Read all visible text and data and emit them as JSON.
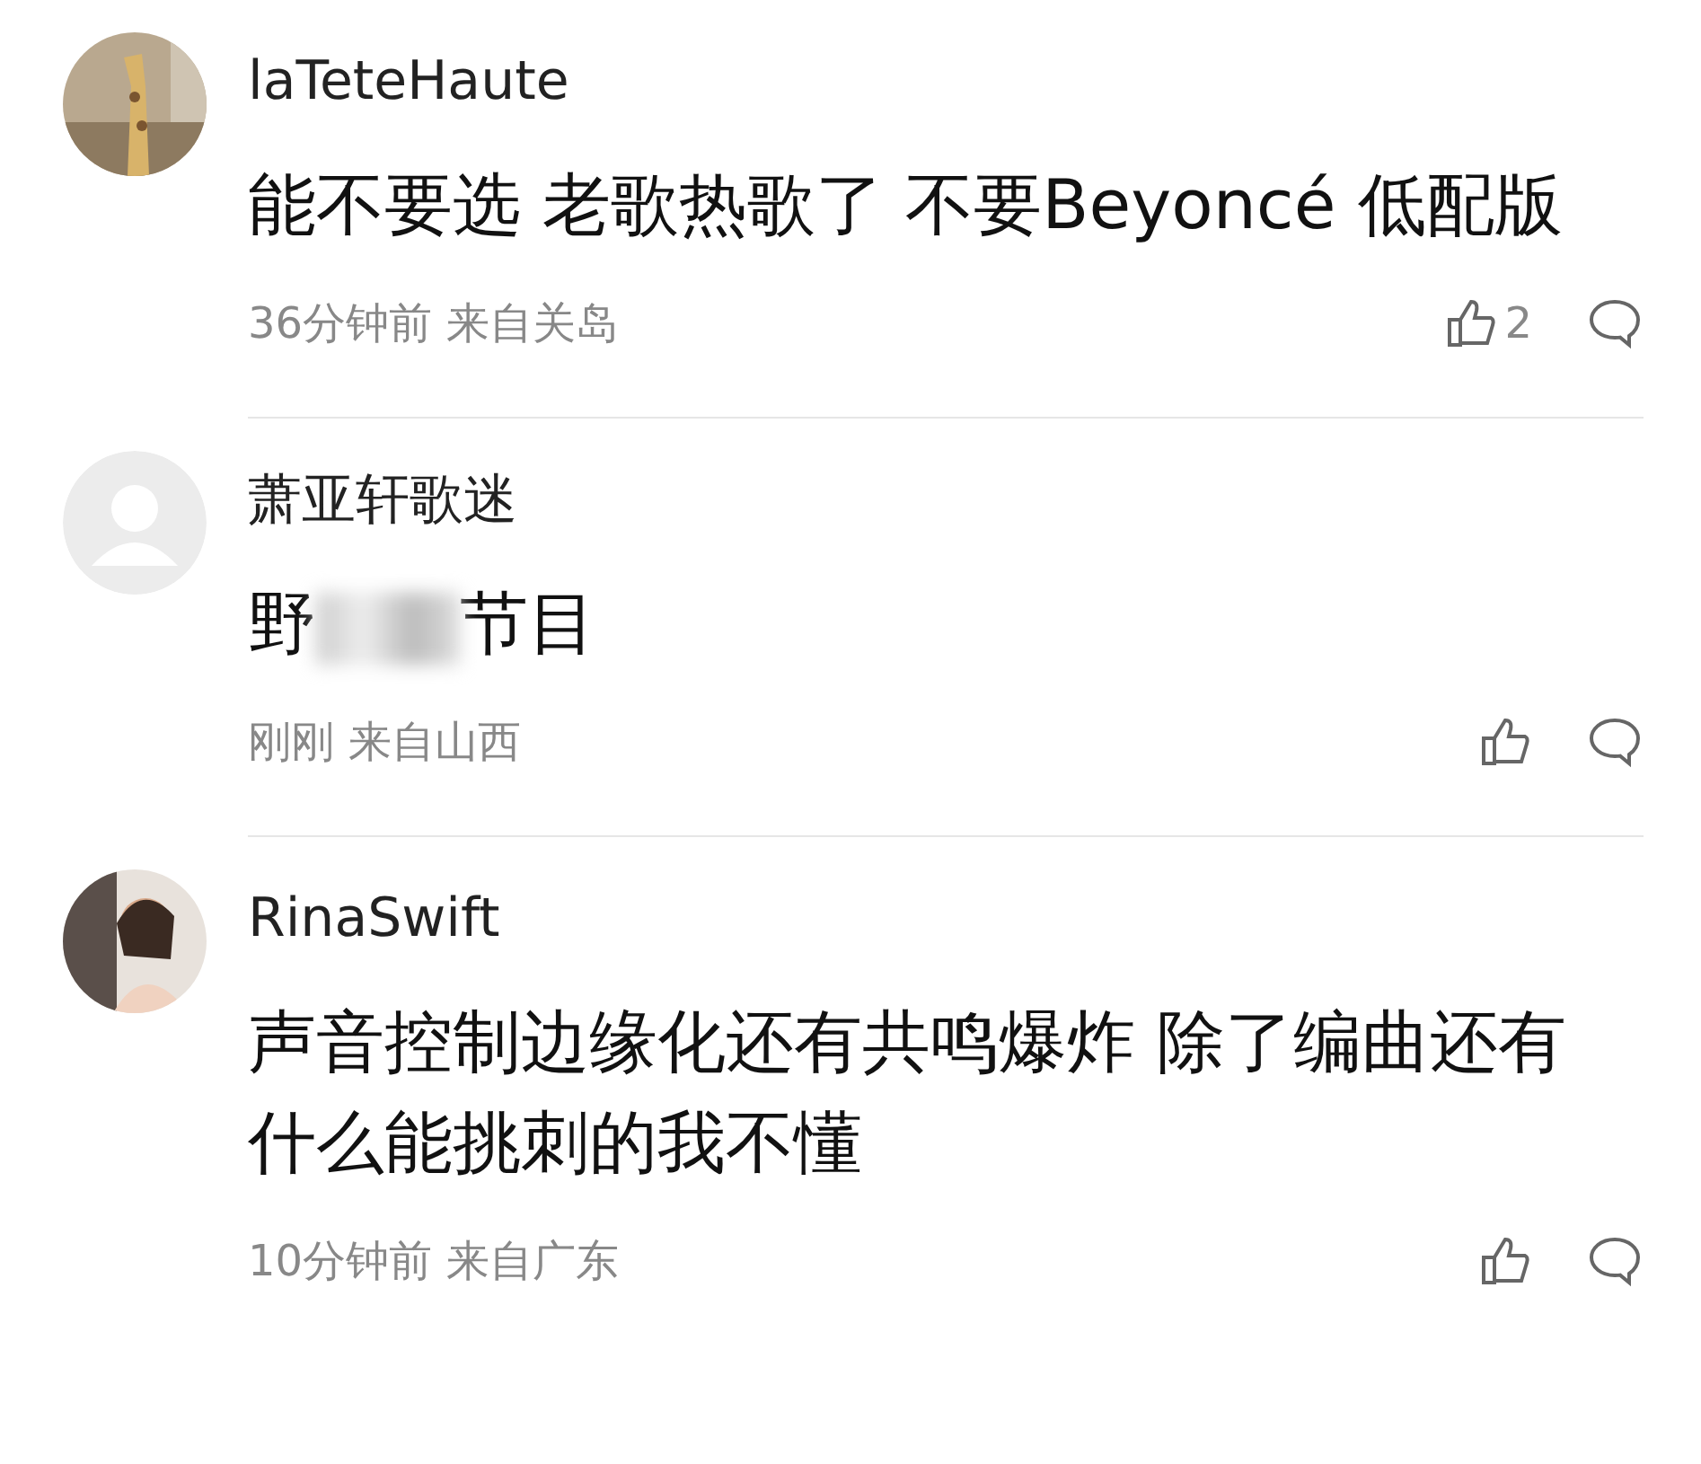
{
  "comments": [
    {
      "user": "laTeteHaute",
      "segments": [
        {
          "kind": "text",
          "text": "能不要选 老歌热歌了 不要Beyoncé 低配版"
        }
      ],
      "time": "36分钟前",
      "location": "来自关岛",
      "likes": "2"
    },
    {
      "user": "萧亚轩歌迷",
      "avatar": {
        "kind": "default"
      },
      "segments": [
        {
          "kind": "text",
          "text": "野"
        },
        {
          "kind": "redacted"
        },
        {
          "kind": "text",
          "text": "节目"
        }
      ],
      "time": "刚刚",
      "location": "来自山西"
    },
    {
      "user": "RinaSwift",
      "segments": [
        {
          "kind": "text",
          "text": "声音控制边缘化还有共鸣爆炸 除了编曲还有什么能挑刺的我不懂"
        }
      ],
      "time": "10分钟前",
      "location": "来自广东"
    }
  ]
}
